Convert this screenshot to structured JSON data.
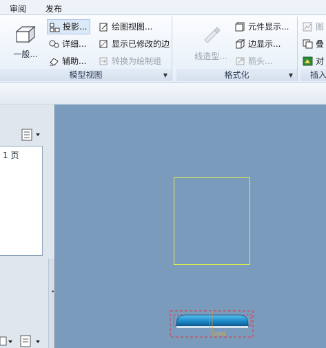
{
  "menu": {
    "items": [
      "审阅",
      "发布"
    ]
  },
  "ribbon": {
    "model_view_group": {
      "label": "模型视图",
      "general_label": "一般...",
      "projection_label": "投影...",
      "detailed_label": "详细...",
      "auxiliary_label": "辅助...",
      "drawing_view_label": "绘图视图...",
      "show_modified_edges_label": "显示已修改的边",
      "convert_to_draw_group_label": "转换为绘制组"
    },
    "format_group": {
      "label": "格式化",
      "line_style_label": "线造型...",
      "element_display_label": "元件显示...",
      "edge_display_label": "边显示...",
      "arrow_label": "箭头..."
    },
    "insert_group": {
      "label": "插入",
      "graph_label": "图",
      "overlay_label": "叠",
      "object_label": "对"
    }
  },
  "left_panel": {
    "page_label": "1 页"
  },
  "canvas": {
    "dimension_text": "DTM1"
  },
  "colors": {
    "canvas_bg": "#7b9bbd",
    "sheet_border": "#e6f04a",
    "model_blue": "#1f8fcf",
    "dashed_box": "#e0303a"
  }
}
